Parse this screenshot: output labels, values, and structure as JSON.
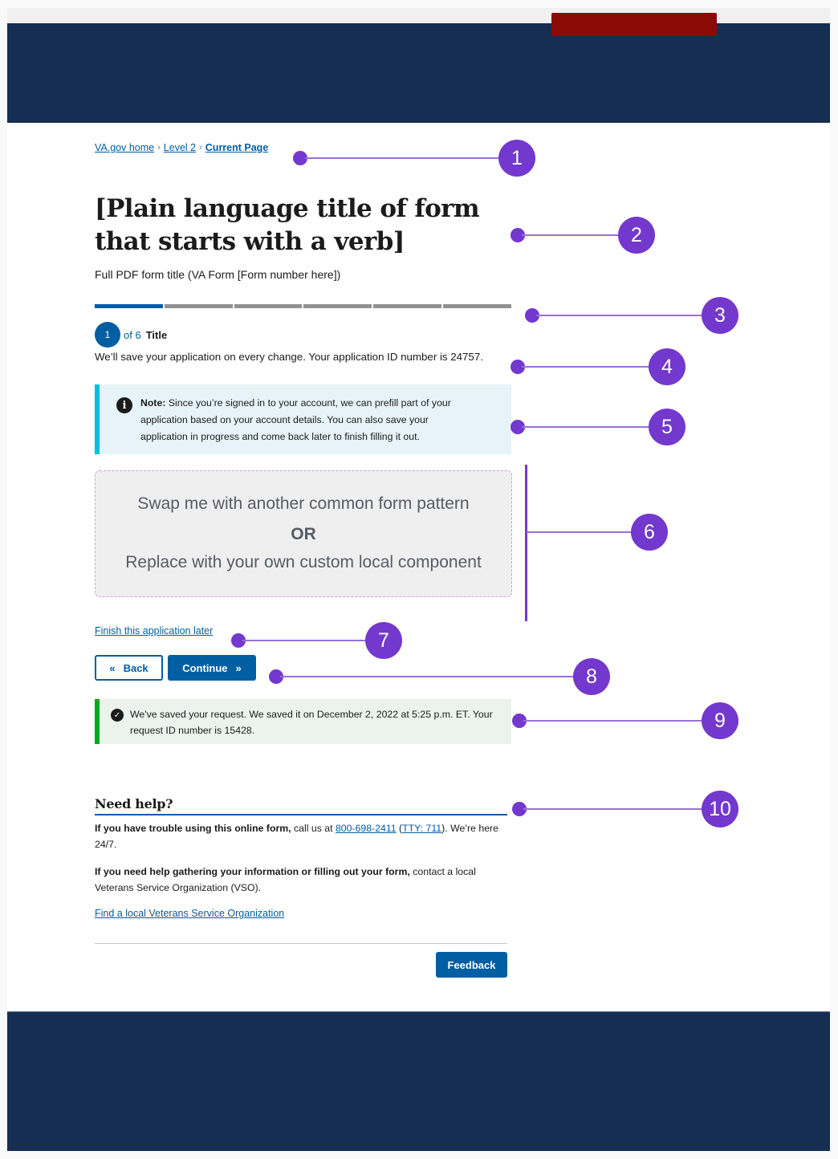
{
  "breadcrumb": {
    "items": [
      "VA.gov home",
      "Level 2",
      "Current Page"
    ],
    "separator": "›"
  },
  "form": {
    "title": "[Plain language title of form that starts with a verb]",
    "subtitle": "Full PDF form title (VA Form [Form number here])",
    "progress": {
      "current_step": 1,
      "total_steps": 6
    },
    "step": {
      "number": "1",
      "of_label": "of 6",
      "label": "Title"
    },
    "save_note": "We’ll save your application on every change. Your application ID number is 24757."
  },
  "info_alert": {
    "icon": "info-icon",
    "bold": "Note:",
    "text": " Since you’re signed in to your account, we can prefill part of your application based on your account details. You can also save your application in progress and come back later to finish filling it out."
  },
  "placeholder": {
    "line1": "Swap me with another common form pattern",
    "line2": "OR",
    "line3": "Replace with your own custom local component"
  },
  "finish_link": "Finish this application later",
  "buttons": {
    "back": "Back",
    "back_icon": "«",
    "continue": "Continue",
    "continue_icon": "»",
    "feedback": "Feedback"
  },
  "success_alert": {
    "icon": "check-circle-icon",
    "text": "We've saved your request. We saved it on December 2, 2022 at 5:25 p.m. ET. Your request ID number is 15428."
  },
  "help": {
    "heading": "Need help?",
    "p1_bold": "If you have trouble using this online form,",
    "p1_text": " call us at ",
    "phone": "800-698-2411",
    "p1_open": " (",
    "tty": "TTY: 711",
    "p1_close": "). We’re here 24/7.",
    "p2_bold": "If you need help gathering your information or filling out your form,",
    "p2_text": " contact a local Veterans Service Organization (VSO).",
    "link": "Find a local Veterans Service Organization"
  },
  "annotations": [
    "1",
    "2",
    "3",
    "4",
    "5",
    "6",
    "7",
    "8",
    "9",
    "10"
  ],
  "colors": {
    "header": "#162e51",
    "header_badge": "#8b0a03",
    "primary": "#005ea2",
    "annotation": "#7338cd",
    "info_border": "#00bde3",
    "success_border": "#00a91c"
  }
}
